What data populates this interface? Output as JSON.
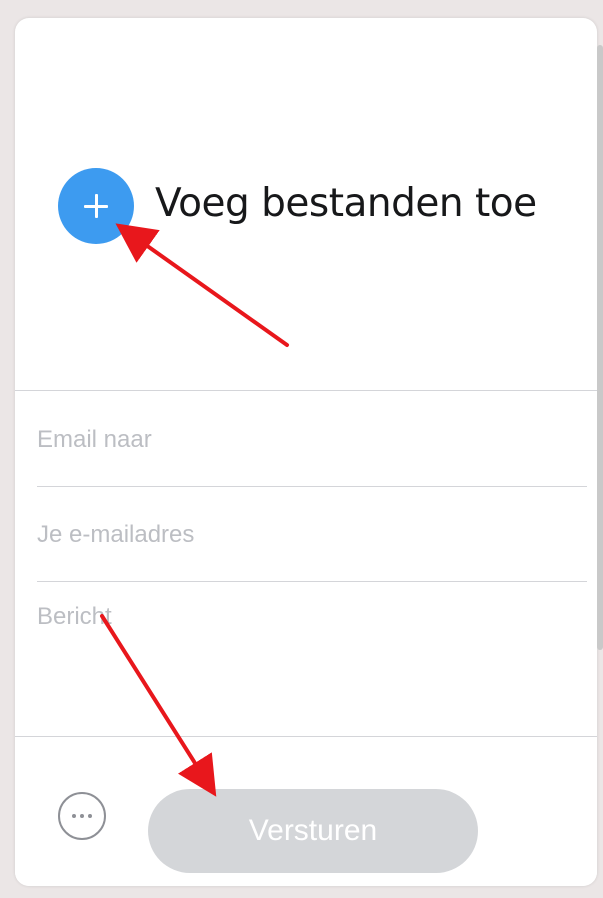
{
  "upload": {
    "add_label": "Voeg bestanden toe"
  },
  "form": {
    "email_to_placeholder": "Email naar",
    "email_from_placeholder": "Je e-mailadres",
    "message_placeholder": "Bericht",
    "send_label": "Versturen"
  },
  "colors": {
    "accent": "#3d9bf0",
    "send_disabled": "#d4d6d9",
    "annotation_arrow": "#e8171c"
  },
  "icons": {
    "add": "plus-icon",
    "options": "more-dots-icon"
  }
}
